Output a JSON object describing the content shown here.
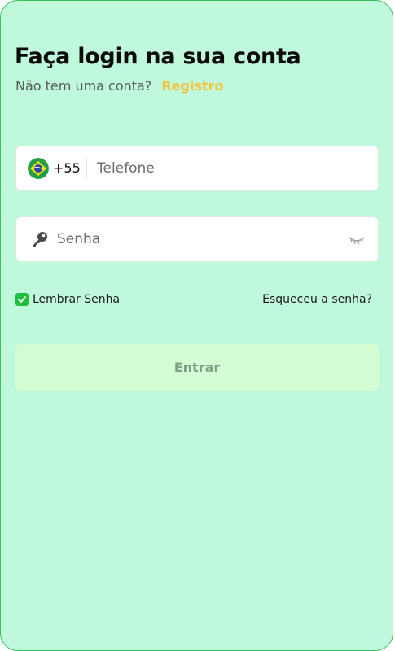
{
  "header": {
    "title": "Faça login na sua conta",
    "subtitle": "Não tem uma conta?",
    "register_link": "Registro"
  },
  "phone": {
    "flag_icon": "brazil-flag-icon",
    "country_code": "+55",
    "placeholder": "Telefone",
    "value": ""
  },
  "password": {
    "icon": "key-icon",
    "placeholder": "Senha",
    "value": "",
    "toggle_icon": "eye-closed-icon"
  },
  "remember": {
    "label": "Lembrar Senha",
    "checked": true
  },
  "forgot_link": "Esqueceu a senha?",
  "submit_label": "Entrar",
  "colors": {
    "background": "#bff8da",
    "accent_link": "#f5c541",
    "checkbox": "#1fbf3c",
    "button_bg": "#d4fdd4",
    "button_text": "#7ea287"
  }
}
